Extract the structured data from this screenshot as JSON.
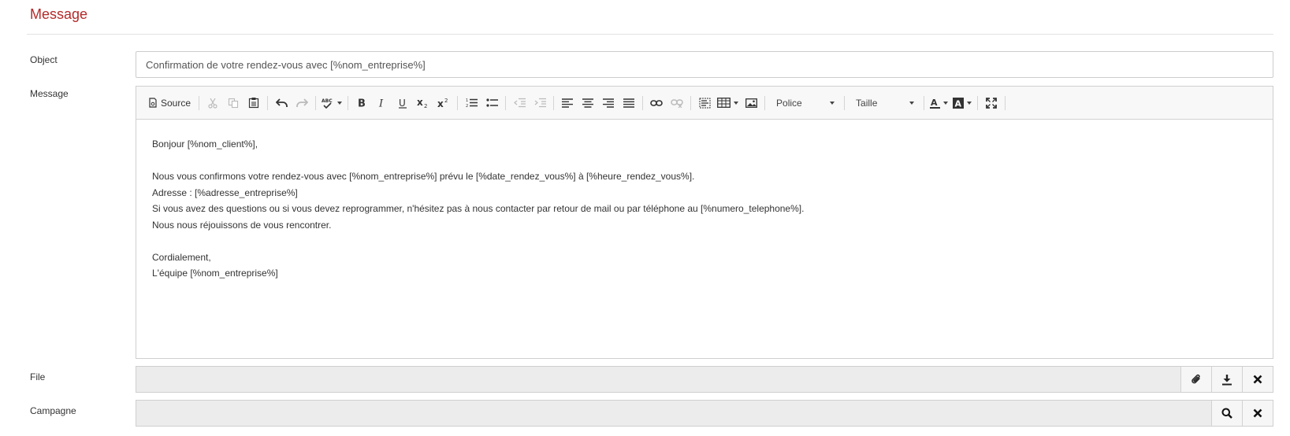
{
  "section": {
    "title": "Message"
  },
  "object": {
    "label": "Object",
    "value": "Confirmation de votre rendez-vous avec [%nom_entreprise%]"
  },
  "message": {
    "label": "Message"
  },
  "toolbar": {
    "source_label": "Source",
    "font_label": "Police",
    "size_label": "Taille"
  },
  "body": {
    "lines": [
      "Bonjour [%nom_client%],",
      "",
      "Nous vous confirmons votre rendez-vous avec [%nom_entreprise%] prévu le [%date_rendez_vous%] à [%heure_rendez_vous%].",
      "Adresse : [%adresse_entreprise%]",
      "Si vous avez des questions ou si vous devez reprogrammer, n'hésitez pas à nous contacter par retour de mail ou par téléphone au [%numero_telephone%].",
      "Nous nous réjouissons de vous rencontrer.",
      "",
      "Cordialement,",
      "L'équipe [%nom_entreprise%]"
    ]
  },
  "file": {
    "label": "File",
    "value": ""
  },
  "campagne": {
    "label": "Campagne",
    "value": ""
  },
  "colors": {
    "title": "#b52a2a"
  }
}
